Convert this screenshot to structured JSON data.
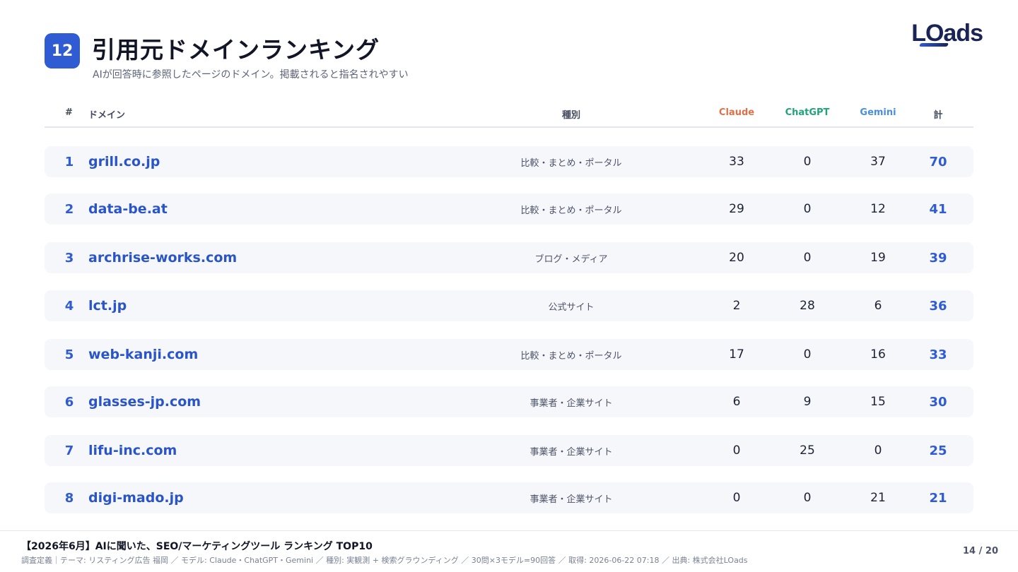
{
  "header": {
    "badge": "12",
    "title": "引用元ドメインランキング",
    "subtitle": "AIが回答時に参照したページのドメイン。掲載されると指名されやすい",
    "logo": "LOads"
  },
  "table": {
    "columns": {
      "rank": "#",
      "domain": "ドメイン",
      "type": "種別",
      "claude": "Claude",
      "chatgpt": "ChatGPT",
      "gemini": "Gemini",
      "total": "計"
    },
    "column_colors": {
      "claude": "#e0704a",
      "chatgpt": "#1fa37a",
      "gemini": "#4a8ee0"
    },
    "rows": [
      {
        "rank": "1",
        "domain": "grill.co.jp",
        "type": "比較・まとめ・ポータル",
        "claude": "33",
        "chatgpt": "0",
        "gemini": "37",
        "total": "70"
      },
      {
        "rank": "2",
        "domain": "data-be.at",
        "type": "比較・まとめ・ポータル",
        "claude": "29",
        "chatgpt": "0",
        "gemini": "12",
        "total": "41"
      },
      {
        "rank": "3",
        "domain": "archrise-works.com",
        "type": "ブログ・メディア",
        "claude": "20",
        "chatgpt": "0",
        "gemini": "19",
        "total": "39"
      },
      {
        "rank": "4",
        "domain": "lct.jp",
        "type": "公式サイト",
        "claude": "2",
        "chatgpt": "28",
        "gemini": "6",
        "total": "36"
      },
      {
        "rank": "5",
        "domain": "web-kanji.com",
        "type": "比較・まとめ・ポータル",
        "claude": "17",
        "chatgpt": "0",
        "gemini": "16",
        "total": "33"
      },
      {
        "rank": "6",
        "domain": "glasses-jp.com",
        "type": "事業者・企業サイト",
        "claude": "6",
        "chatgpt": "9",
        "gemini": "15",
        "total": "30"
      },
      {
        "rank": "7",
        "domain": "lifu-inc.com",
        "type": "事業者・企業サイト",
        "claude": "0",
        "chatgpt": "25",
        "gemini": "0",
        "total": "25"
      },
      {
        "rank": "8",
        "domain": "digi-mado.jp",
        "type": "事業者・企業サイト",
        "claude": "0",
        "chatgpt": "0",
        "gemini": "21",
        "total": "21"
      }
    ]
  },
  "footer": {
    "title": "【2026年6月】AIに聞いた、SEO/マーケティングツール ランキング TOP10",
    "meta": "調査定義｜テーマ: リスティング広告 福岡 ／ モデル: Claude・ChatGPT・Gemini ／ 種別: 実観測 + 検索グラウンディング ／ 30問×3モデル=90回答 ／ 取得: 2026-06-22 07:18 ／ 出典: 株式会社LOads",
    "page": "14 / 20"
  }
}
